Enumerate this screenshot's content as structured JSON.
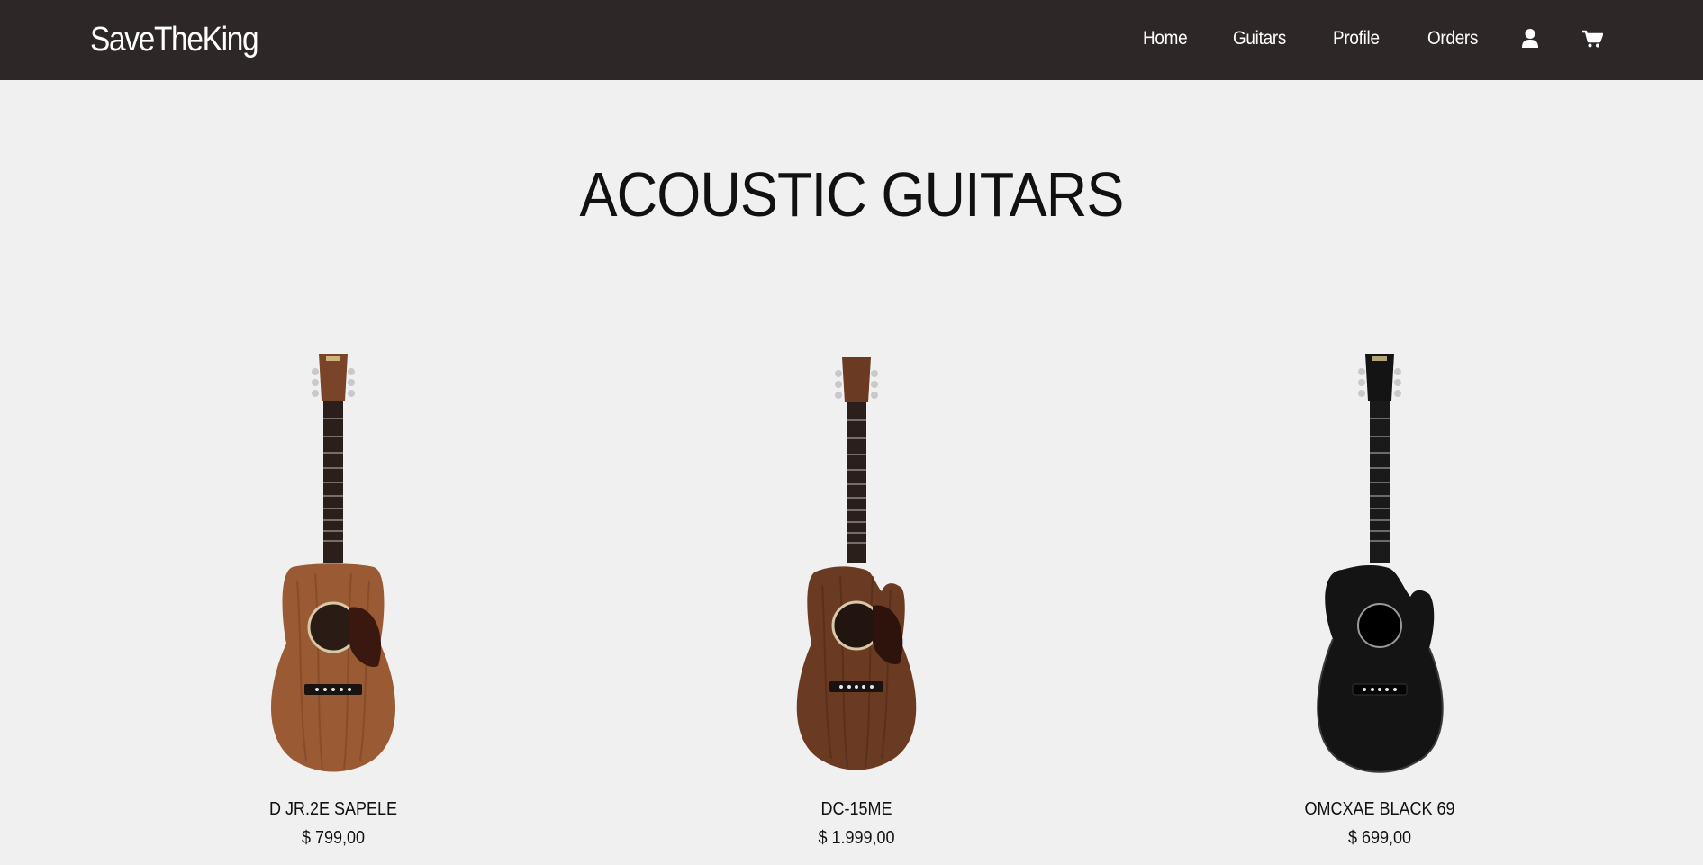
{
  "navbar": {
    "brand": "SaveTheKing",
    "links": [
      {
        "label": "Home"
      },
      {
        "label": "Guitars"
      },
      {
        "label": "Profile"
      },
      {
        "label": "Orders"
      }
    ],
    "icons": [
      "user-icon",
      "shopping-cart-icon"
    ]
  },
  "page": {
    "title": "ACOUSTIC GUITARS"
  },
  "products": [
    {
      "name": "D JR.2E SAPELE",
      "price": "$ 799,00",
      "finish": "#9a5a34"
    },
    {
      "name": "DC-15ME",
      "price": "$ 1.999,00",
      "finish": "#6b3a22"
    },
    {
      "name": "OMCXAE BLACK 69",
      "price": "$ 699,00",
      "finish": "#141414"
    }
  ],
  "colors": {
    "navbar_bg": "#2d2827",
    "page_bg": "#f1f0f0",
    "text": "#111111"
  }
}
